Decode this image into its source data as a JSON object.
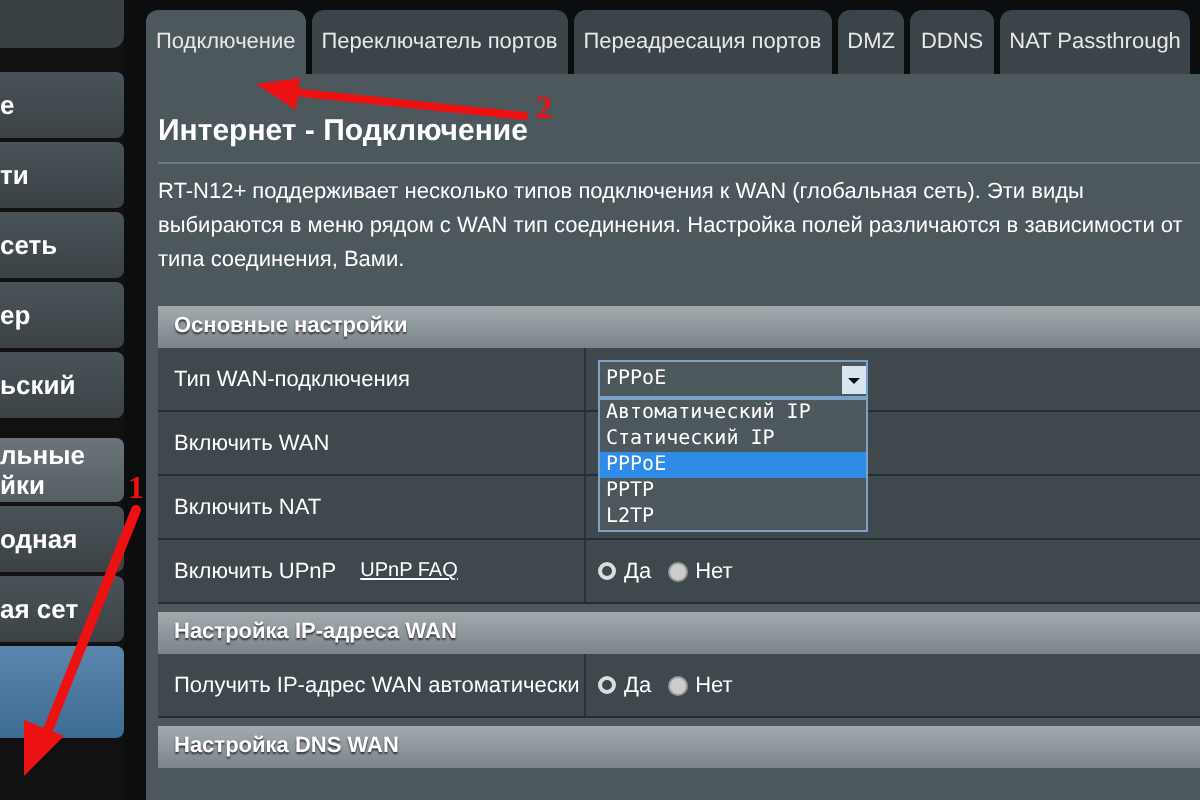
{
  "sidebar": {
    "items": [
      {
        "label": "е",
        "kind": "item",
        "selected": false
      },
      {
        "label": "ти",
        "kind": "item",
        "selected": false
      },
      {
        "label": "сеть",
        "kind": "item",
        "selected": false
      },
      {
        "label": "ер",
        "kind": "item",
        "selected": false
      },
      {
        "label": "ьский",
        "kind": "item",
        "selected": false
      },
      {
        "label": "льные\nйки",
        "kind": "header",
        "selected": false
      },
      {
        "label": "одная",
        "kind": "item",
        "selected": false
      },
      {
        "label": "ая сет",
        "kind": "item",
        "selected": false
      },
      {
        "kind": "item",
        "selected": true
      }
    ]
  },
  "tabs": [
    {
      "label": "Подключение",
      "selected": true
    },
    {
      "label": "Переключатель портов",
      "selected": false
    },
    {
      "label": "Переадресация портов",
      "selected": false
    },
    {
      "label": "DMZ",
      "selected": false
    },
    {
      "label": "DDNS",
      "selected": false
    },
    {
      "label": "NAT Passthrough",
      "selected": false
    }
  ],
  "page_title": "Интернет - Подключение",
  "description": "RT-N12+ поддерживает несколько типов подключения к WAN (глобальная сеть). Эти виды выбираются в меню рядом с WAN тип соединения. Настройка полей различаются в зависимости от типа соединения, Вами.",
  "sections": [
    {
      "title": "Основные настройки",
      "rows": [
        {
          "label": "Тип WAN-подключения",
          "kind": "select",
          "value": "PPPoE",
          "expanded": true,
          "options": [
            {
              "label": "Автоматический IP",
              "selected": false
            },
            {
              "label": "Статический IP",
              "selected": false
            },
            {
              "label": "PPPoE",
              "selected": true
            },
            {
              "label": "PPTP",
              "selected": false
            },
            {
              "label": "L2TP",
              "selected": false
            }
          ]
        },
        {
          "label": "Включить WAN",
          "kind": "empty"
        },
        {
          "label": "Включить NAT",
          "kind": "empty"
        },
        {
          "label": "Включить UPnP",
          "kind": "radio",
          "link": "UPnP  FAQ",
          "options": [
            {
              "label": "Да",
              "selected": true
            },
            {
              "label": "Нет",
              "selected": false
            }
          ]
        }
      ]
    },
    {
      "title": "Настройка IP-адреса WAN",
      "rows": [
        {
          "label": "Получить IP-адрес WAN автоматически",
          "kind": "radio",
          "options": [
            {
              "label": "Да",
              "selected": true
            },
            {
              "label": "Нет",
              "selected": false
            }
          ]
        }
      ]
    },
    {
      "title": "Настройка DNS WAN"
    }
  ],
  "annotations": [
    {
      "label": "1"
    },
    {
      "label": "2"
    }
  ]
}
